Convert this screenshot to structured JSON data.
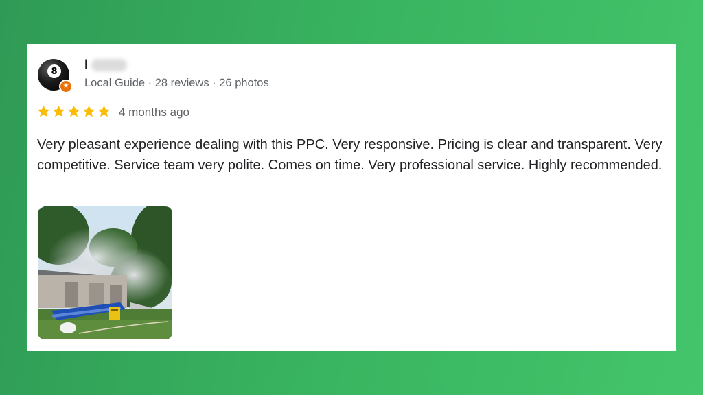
{
  "reviewer": {
    "name": "I",
    "meta": "Local Guide · 28 reviews · 26 photos",
    "avatar_number": "8"
  },
  "rating": {
    "stars": 5,
    "out_of": 5,
    "when": "4 months ago"
  },
  "review": {
    "text": "Very pleasant experience dealing with this PPC. Very responsive. Pricing is clear and transparent. Very competitive. Service team very polite. Comes on time. Very professional service. Highly recommended."
  },
  "colors": {
    "background_green": "#38b25f",
    "star": "#fbbc04",
    "local_guide_badge": "#e8710a"
  }
}
